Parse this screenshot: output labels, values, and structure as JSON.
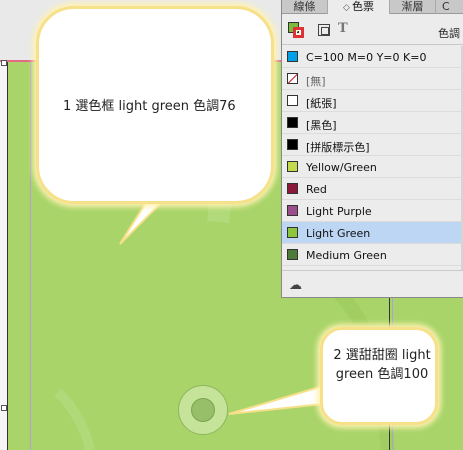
{
  "colors": {
    "page_green": "#a8d469",
    "cyan": "#00a0e9",
    "yellow_green": "#c4d94e",
    "red": "#8b1a3a",
    "light_purple": "#9a4e8a",
    "light_green": "#8cc63f",
    "medium_green": "#4e7a3a",
    "selection": "#bcd6f4"
  },
  "panel": {
    "tabs": [
      "線條",
      "色票",
      "漸層",
      "C"
    ],
    "tint_label": "色調"
  },
  "swatches": [
    {
      "name": "C=100 M=0 Y=0 K=0",
      "color": "#00a0e9"
    },
    {
      "name": "[無]",
      "color": "none"
    },
    {
      "name": "[紙張]",
      "color": "#ffffff"
    },
    {
      "name": "[黑色]",
      "color": "#000000"
    },
    {
      "name": "[拼版標示色]",
      "color": "#000000"
    },
    {
      "name": "Yellow/Green",
      "color": "#c4d94e"
    },
    {
      "name": "Red",
      "color": "#8b1a3a"
    },
    {
      "name": "Light Purple",
      "color": "#9a4e8a"
    },
    {
      "name": "Light Green",
      "color": "#8cc63f"
    },
    {
      "name": "Medium Green",
      "color": "#4e7a3a"
    }
  ],
  "callouts": {
    "first": "1 選色框 light green 色調76",
    "second": "2 選甜甜圈 light green 色調100"
  },
  "icons": {
    "fill_stroke": "fill-stroke-icon",
    "container": "container-icon",
    "text": "text-formatting-icon",
    "cloud": "cloud-library-icon"
  }
}
